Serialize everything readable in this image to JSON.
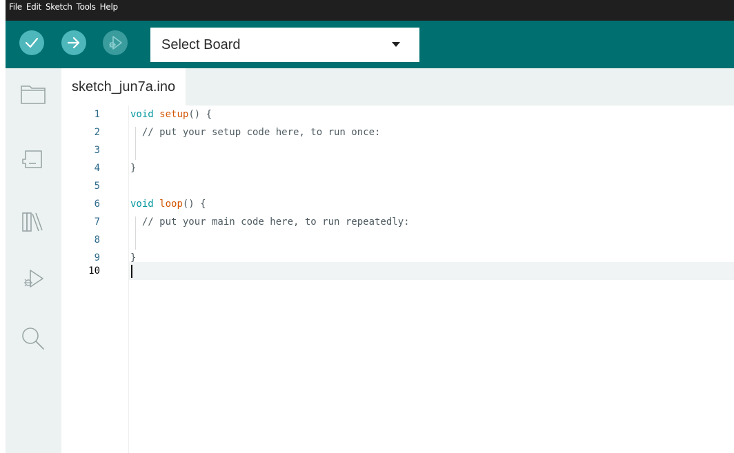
{
  "menubar": {
    "items": [
      "File",
      "Edit",
      "Sketch",
      "Tools",
      "Help"
    ]
  },
  "toolbar": {
    "verify_icon": "check-icon",
    "upload_icon": "arrow-right-icon",
    "debug_icon": "debug-icon",
    "board_select": {
      "value": "Select Board"
    }
  },
  "sidebar": {
    "items": [
      "folder-icon",
      "board-manager-icon",
      "library-icon",
      "debug-icon",
      "search-icon"
    ]
  },
  "editor": {
    "tab_label": "sketch_jun7a.ino",
    "lines": [
      {
        "num": "1",
        "text": "void setup() {"
      },
      {
        "num": "2",
        "text": "  // put your setup code here, to run once:"
      },
      {
        "num": "3",
        "text": ""
      },
      {
        "num": "4",
        "text": "}"
      },
      {
        "num": "5",
        "text": ""
      },
      {
        "num": "6",
        "text": "void loop() {"
      },
      {
        "num": "7",
        "text": "  // put your main code here, to run repeatedly:"
      },
      {
        "num": "8",
        "text": ""
      },
      {
        "num": "9",
        "text": "}"
      },
      {
        "num": "10",
        "text": ""
      }
    ],
    "active_line": "10"
  },
  "colors": {
    "toolbar": "#006f70",
    "button": "#4db7bb",
    "keyword": "#00979d",
    "function": "#d35400",
    "comment": "#95a5a6"
  }
}
